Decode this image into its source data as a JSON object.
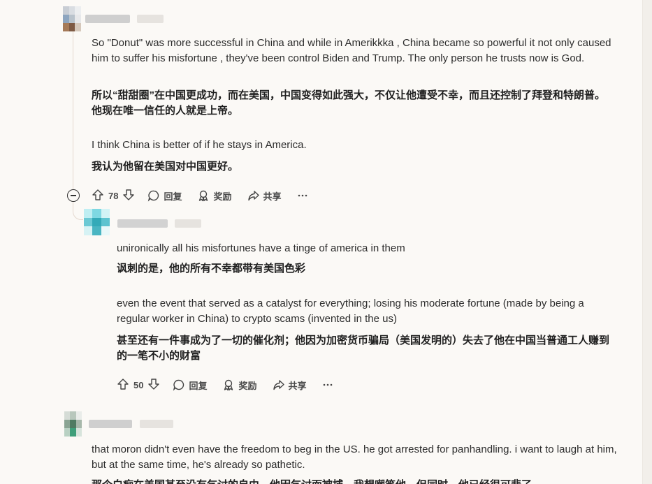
{
  "comments": [
    {
      "paragraphs": [
        "So \"Donut\" was more successful in China and while in Amerikkka , China became so powerful it not only caused him to suffer his misfortune , they've been control Biden and Trump. The only person he trusts now is God.",
        "所以“甜甜圈”在中国更成功，而在美国，中国变得如此强大，不仅让他遭受不幸，而且还控制了拜登和特朗普。他现在唯一信任的人就是上帝。",
        "I think China is better of if he stays in America.",
        "我认为他留在美国对中国更好。"
      ],
      "votes": "78",
      "reply_label": "回复",
      "award_label": "奖励",
      "share_label": "共享"
    },
    {
      "paragraphs": [
        "unironically all his misfortunes have a tinge of america in them",
        "讽刺的是，他的所有不幸都带有美国色彩",
        "even the event that served as a catalyst for everything; losing his moderate fortune (made by being a regular worker in China) to crypto scams (invented in the us)",
        "甚至还有一件事成为了一切的催化剂；他因为加密货币骗局（美国发明的）失去了他在中国当普通工人赚到的一笔不小的财富"
      ],
      "votes": "50",
      "reply_label": "回复",
      "award_label": "奖励",
      "share_label": "共享"
    },
    {
      "paragraphs": [
        "that moron didn't even have the freedom to beg in the US. he got arrested for panhandling. i want to laugh at him, but at the same time, he's already so pathetic.",
        "那个白痴在美国甚至没有乞讨的自由。他因乞讨而被捕。我想嘲笑他，但同时，他已经很可悲了。"
      ]
    }
  ],
  "icons": {
    "upvote": "arrow-up-icon",
    "downvote": "arrow-down-icon",
    "reply": "speech-bubble-icon",
    "award": "award-ribbon-icon",
    "share": "share-arrow-icon",
    "more": "ellipsis-icon",
    "collapse": "collapse-minus-icon"
  }
}
